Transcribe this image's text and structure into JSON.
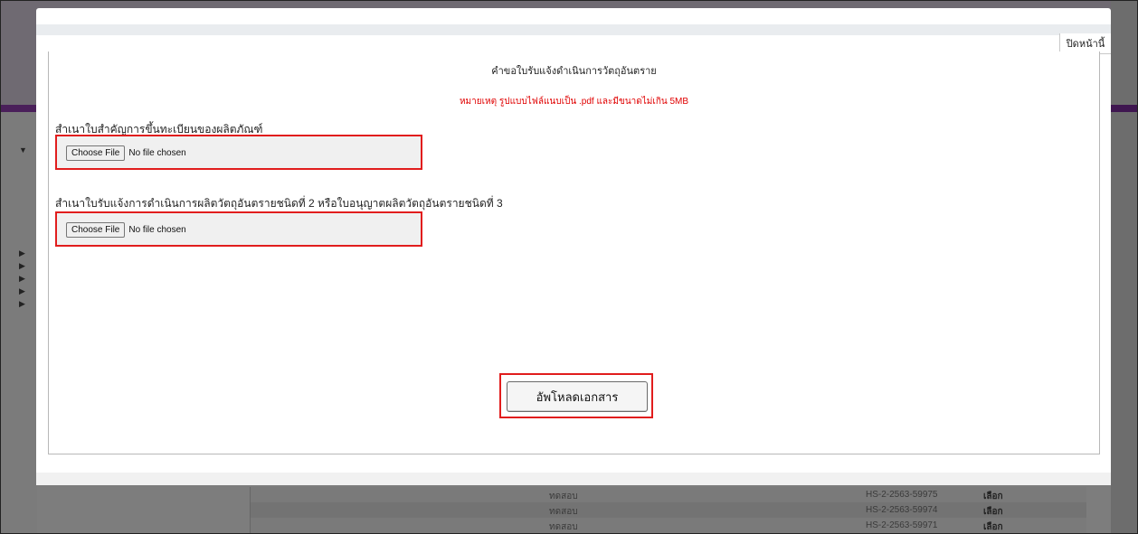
{
  "modal": {
    "close_label": "ปิดหน้านี้",
    "title": "คำขอใบรับแจ้งดำเนินการวัตถุอันตราย",
    "note": "หมายเหตุ รูปแบบไฟล์แนบเป็น .pdf และมีขนาดไม่เกิน 5MB",
    "fields": [
      {
        "label": "สำเนาใบสำคัญการขึ้นทะเบียนของผลิตภัณฑ์",
        "button_label": "Choose File",
        "status": "No file chosen"
      },
      {
        "label": "สำเนาใบรับแจ้งการดำเนินการผลิตวัตถุอันตรายชนิดที่ 2 หรือใบอนุญาตผลิตวัตถุอันตรายชนิดที่ 3",
        "button_label": "Choose File",
        "status": "No file chosen"
      }
    ],
    "upload_label": "อัพโหลดเอกสาร"
  },
  "background_table": {
    "rows": [
      {
        "name": "ทดสอบ",
        "code": "HS-2-2563-59975",
        "action": "เลือก"
      },
      {
        "name": "ทดสอบ",
        "code": "HS-2-2563-59974",
        "action": "เลือก"
      },
      {
        "name": "ทดสอบ",
        "code": "HS-2-2563-59971",
        "action": "เลือก"
      }
    ]
  },
  "colors": {
    "highlight_border": "#e11d1d",
    "note_text": "#e00000",
    "brand_purple": "#4a1f5a",
    "overlay": "#7d7d7d"
  }
}
